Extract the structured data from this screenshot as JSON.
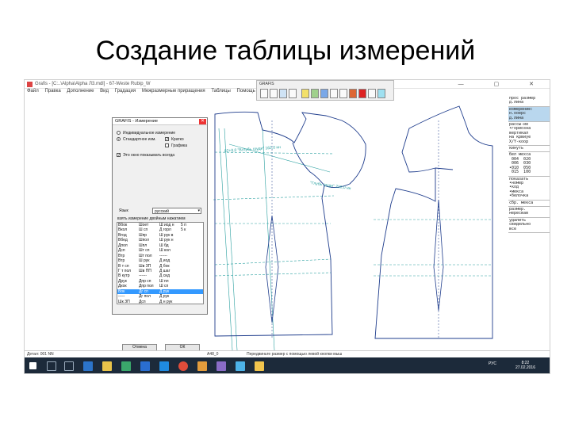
{
  "slide": {
    "title": "Создание таблицы измерений"
  },
  "window": {
    "title": "Grafis - [C:..\\Alpha\\Alpha Л3.mdl] - 67-Weste Rubip_W",
    "menu": [
      "Файл",
      "Правка",
      "Дополнение",
      "Вид",
      "Градация",
      "Межразмерные приращения",
      "Таблицы",
      "Помощь"
    ],
    "toolbar_title": "GRAFIS"
  },
  "dialog": {
    "title": "GRAFIS - Измерение",
    "close": "✕",
    "radio_individual": "Индивидуальное измерение",
    "radio_standard": "Стандартное изм.",
    "check_short": "Кратко",
    "check_graphic": "Графика",
    "check_show_always": "Это окно показывать всегда",
    "language_label": "Язык",
    "language_value": "русский",
    "instruction": "взять измерение двойным нажатием",
    "measurements": [
      [
        "Вбок",
        "Шоет",
        "Ш иод н",
        "5 п"
      ],
      [
        "Вкол",
        "Ш сп",
        "Д горл",
        "5 к"
      ],
      [
        "Вгод",
        "Шпр",
        "Ш рук в",
        ""
      ],
      [
        "Вбед",
        "Шпол",
        "Ш рук н",
        ""
      ],
      [
        "Дпол",
        "Шпл",
        "Ш бд",
        ""
      ],
      [
        "Дсп",
        "Шт сп",
        "Ш кол",
        ""
      ],
      [
        "Втр",
        "Шт пол",
        "------",
        ""
      ],
      [
        "Втр",
        "Ш рук",
        "Д иод",
        ""
      ],
      [
        "В т сп",
        "Шв ЗП",
        "Д бок",
        ""
      ],
      [
        "Г т пол",
        "Шв ПП",
        "Д шаг",
        ""
      ],
      [
        "В кутр",
        "------",
        "Д сид",
        ""
      ],
      [
        "Друк",
        "Дпр сп",
        "Ш пл",
        ""
      ],
      [
        "Дкок",
        "Дпр пол",
        "Ш сп",
        ""
      ],
      [
        "Вок",
        "Дг сп",
        "Д рук",
        ""
      ],
      [
        "-----",
        "Дг пол",
        "Д рук",
        ""
      ],
      [
        "Шк ЗП",
        "Дсп",
        "Д н рук",
        ""
      ],
      [
        "Шк ПП",
        "Дсп пол",
        "Д н рук",
        ""
      ],
      [
        "Ш ЗП",
        "------",
        "Д нк",
        ""
      ],
      [
        "Шб ПП",
        "Ш иод",
        "Д борт",
        ""
      ],
      [
        "Шсед ЗП",
        "Ш тал",
        "Ш пол",
        ""
      ],
      [
        "Шпол ПП",
        "Ш бед",
        "Д нарн.",
        ""
      ],
      [
        "Штал ЗП",
        "Ш У1",
        "К бор",
        ""
      ],
      [
        "Штал ПП",
        "Ш У2",
        "------",
        ""
      ],
      [
        "Шгр",
        "Ш У3",
        "5 в",
        ""
      ]
    ],
    "selected_row": 13,
    "cancel_label": "Отмена",
    "ok_label": "ОК"
  },
  "right_panel": {
    "items": [
      {
        "text": "прос размер\nд.лина",
        "highlight": false
      },
      {
        "text": "измерение:\nн.ооерс\nд.лина",
        "highlight": false
      },
      {
        "text": "рассы-ие\n•гориозна\nвертикал\nна крвиуе\nX/Y-коор",
        "highlight": false
      },
      {
        "text": "кинуть",
        "highlight": false
      },
      {
        "text": "бел мехса\n 004  020\n 006  030\n•010  050\n 015  100",
        "highlight": false
      },
      {
        "text": "показать\n•номер\n•код\n•мекса\n•белочка",
        "highlight": false
      },
      {
        "text": "сбр. мекса",
        "highlight": false
      },
      {
        "text": "размер.\nнересвав",
        "highlight": false
      },
      {
        "text": "удалить\nсвидельно\nвсе",
        "highlight": false
      }
    ]
  },
  "status": {
    "left": "Детал: 001  NN",
    "middle": "А48_0",
    "hint": "Передвиньте размер с помощью левой кнопки мыш"
  },
  "canvas": {
    "annotations": [
      "82+8,0 \"Вглубь груди\" 162,0 нн",
      "\"Глубь груди\" 210,0 нн"
    ]
  },
  "taskbar": {
    "lang": "РУС",
    "time": "8:22",
    "date": "27.02.2016"
  },
  "colors": {
    "pattern_line": "#1e3c8c",
    "construction_line": "#2aa0a0",
    "taskbar_bg": "#1c2a3a",
    "selection": "#3399ff"
  }
}
